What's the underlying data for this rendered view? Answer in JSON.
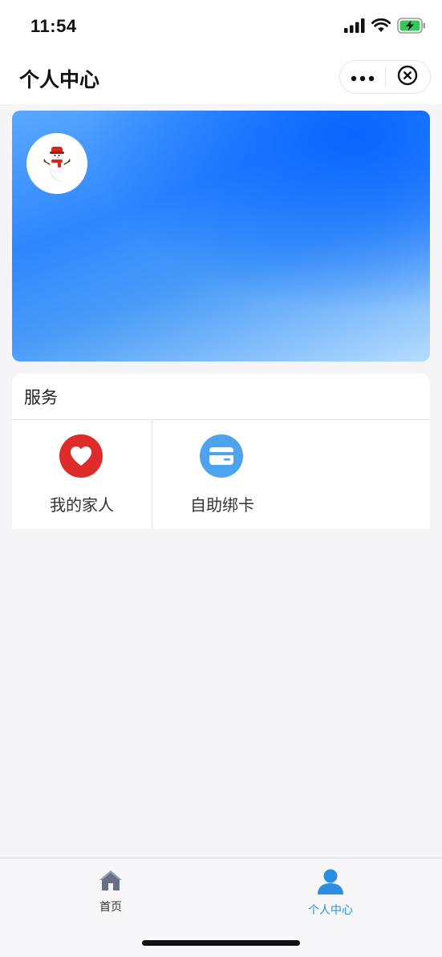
{
  "status_bar": {
    "time": "11:54",
    "icons": [
      "signal-icon",
      "wifi-icon",
      "battery-charging-icon"
    ]
  },
  "nav": {
    "title": "个人中心",
    "more_icon": "more-icon",
    "close_icon": "close-circle-icon"
  },
  "banner": {
    "avatar_icon": "snowman-avatar"
  },
  "services": {
    "title": "服务",
    "items": [
      {
        "label": "我的家人",
        "icon": "heart-icon",
        "color": "#e02b2b"
      },
      {
        "label": "自助绑卡",
        "icon": "card-icon",
        "color": "#4da3f0"
      }
    ]
  },
  "tab_bar": {
    "tabs": [
      {
        "label": "首页",
        "icon": "home-icon",
        "active": false
      },
      {
        "label": "个人中心",
        "icon": "person-icon",
        "active": true
      }
    ],
    "active_color": "#2b8ee0"
  }
}
